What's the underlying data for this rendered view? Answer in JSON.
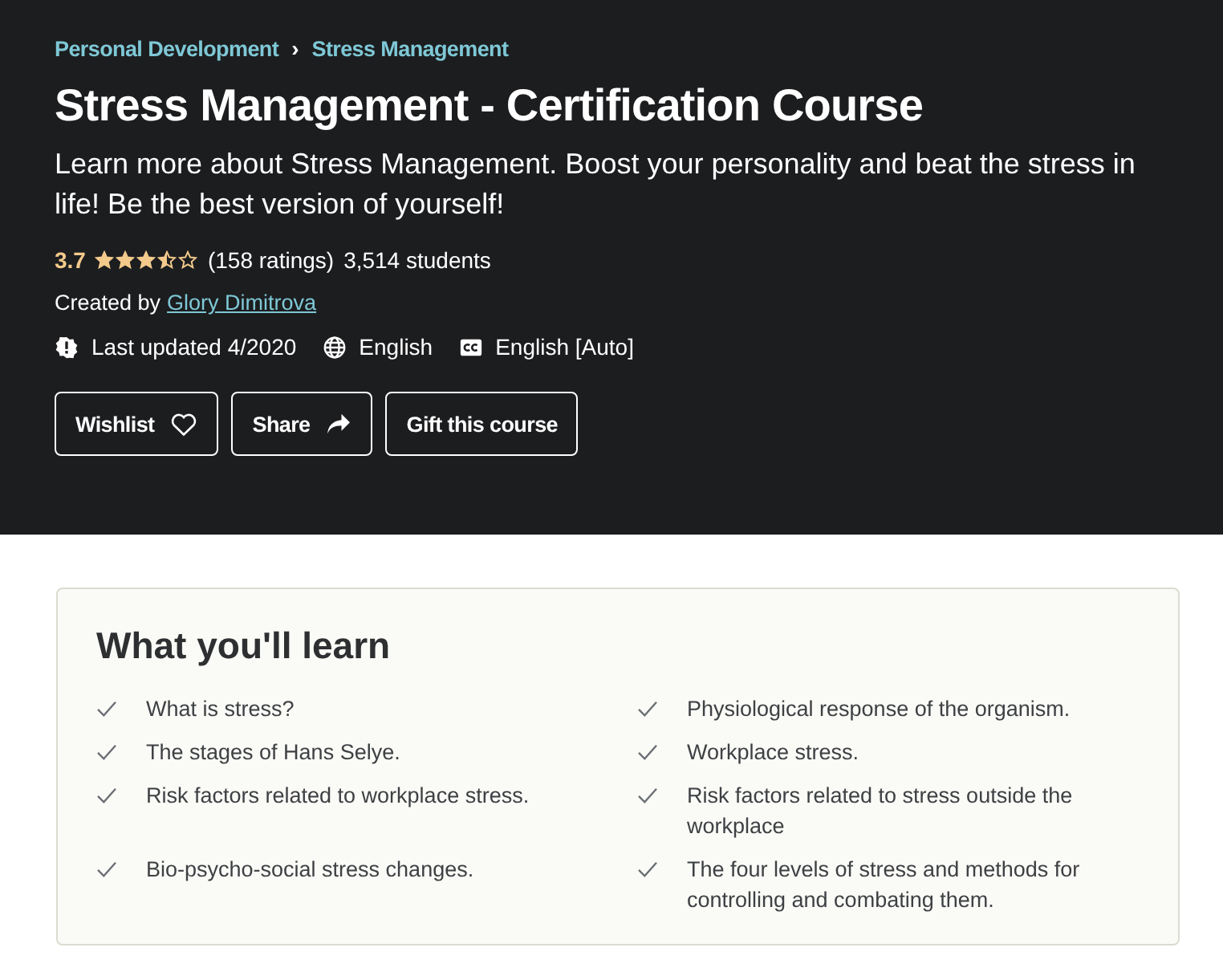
{
  "breadcrumb": [
    {
      "label": "Personal Development"
    },
    {
      "label": "Stress Management"
    }
  ],
  "breadcrumb_separator": "›",
  "title": "Stress Management - Certification Course",
  "description": "Learn more about Stress Management. Boost your personality and beat the stress in life! Be the best version of yourself!",
  "rating": {
    "value": "3.7",
    "stars": 3.5,
    "count": "(158 ratings)",
    "students": "3,514 students"
  },
  "created_by": {
    "label": "Created by",
    "author": "Glory Dimitrova"
  },
  "meta": [
    {
      "kind": "updated",
      "text": "Last updated 4/2020"
    },
    {
      "kind": "language",
      "text": "English"
    },
    {
      "kind": "captions",
      "text": "English [Auto]"
    }
  ],
  "buttons": [
    {
      "label": "Wishlist",
      "kind": "wishlist"
    },
    {
      "label": "Share",
      "kind": "share"
    },
    {
      "label": "Gift this course",
      "kind": "gift"
    }
  ],
  "learn": {
    "heading": "What you'll learn",
    "items": [
      "What is stress?",
      "Physiological response of the organism.",
      "The stages of Hans Selye.",
      "Workplace stress.",
      "Risk factors related to workplace stress.",
      "Risk factors related to stress outside the workplace",
      "Bio-psycho-social stress changes.",
      "The four levels of stress and methods for controlling and combating them."
    ]
  }
}
